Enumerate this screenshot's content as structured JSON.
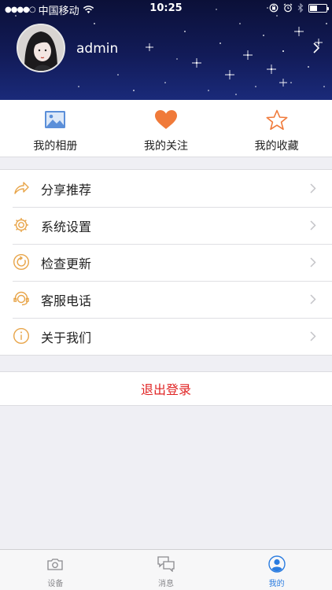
{
  "status_bar": {
    "signal_dots": "●●●●○",
    "carrier": "中国移动",
    "time": "10:25"
  },
  "profile": {
    "username": "admin"
  },
  "quick_links": [
    {
      "label": "我的相册",
      "icon": "photo-icon",
      "color": "#5b8fd9"
    },
    {
      "label": "我的关注",
      "icon": "heart-icon",
      "color": "#f07a3a"
    },
    {
      "label": "我的收藏",
      "icon": "star-icon",
      "color": "#f07a3a"
    }
  ],
  "menu": [
    {
      "label": "分享推荐",
      "icon": "share-icon"
    },
    {
      "label": "系统设置",
      "icon": "gear-icon"
    },
    {
      "label": "检查更新",
      "icon": "refresh-icon"
    },
    {
      "label": "客服电话",
      "icon": "headset-icon"
    },
    {
      "label": "关于我们",
      "icon": "info-icon"
    }
  ],
  "logout_label": "退出登录",
  "tabs": [
    {
      "label": "设备",
      "icon": "camera-icon",
      "active": false
    },
    {
      "label": "消息",
      "icon": "chat-icon",
      "active": false
    },
    {
      "label": "我的",
      "icon": "user-icon",
      "active": true
    }
  ],
  "colors": {
    "accent": "#2a7ce0",
    "menu_icon": "#e8a54a",
    "logout": "#e02424"
  }
}
